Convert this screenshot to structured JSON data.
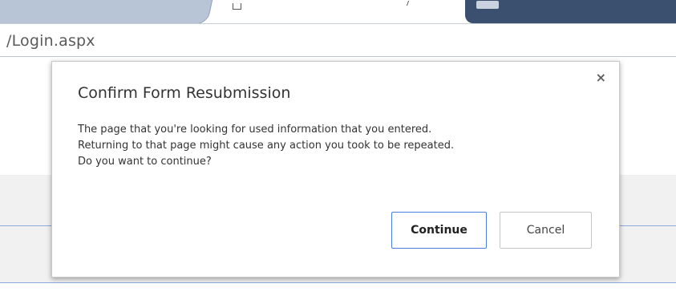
{
  "browser": {
    "address_text": "/Login.aspx"
  },
  "dialog": {
    "title": "Confirm Form Resubmission",
    "close_glyph": "×",
    "body_lines": [
      "The page that you're looking for used information that you entered.",
      "Returning to that page might cause any action you took to be repeated.",
      "Do you want to continue?"
    ],
    "continue_label": "Continue",
    "cancel_label": "Cancel"
  },
  "colors": {
    "primary_button_border": "#4a7fe0",
    "tab_dark": "#3b506f",
    "page_rule": "#8aaae0"
  },
  "icons": {
    "tab_icon": "document-icon",
    "close": "close-icon"
  }
}
